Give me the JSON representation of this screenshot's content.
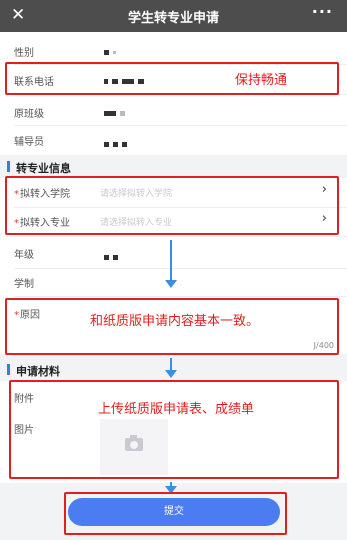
{
  "header": {
    "close_icon": "close-icon",
    "title": "学生转专业申请",
    "more": "···"
  },
  "basic_info": {
    "gender_label": "性别",
    "phone_label": "联系电话",
    "original_class_label": "原班级",
    "counselor_label": "辅导员"
  },
  "transfer_section": {
    "title": "转专业信息",
    "college_label": "拟转入学院",
    "college_placeholder": "请选择拟转入学院",
    "major_label": "拟转入专业",
    "major_placeholder": "请选择拟转入专业",
    "grade_label": "年级",
    "duration_label": "学制",
    "reason_label": "原因",
    "reason_counter": "J/400"
  },
  "materials_section": {
    "title": "申请材料",
    "attachment_label": "附件",
    "image_label": "图片"
  },
  "submit_label": "提交",
  "annotations": {
    "phone_note": "保持畅通",
    "reason_note": "和纸质版申请内容基本一致。",
    "materials_note": "上传纸质版申请表、成绩单"
  },
  "colors": {
    "header_bg": "#4d4d4d",
    "accent": "#4c7cf2",
    "annotation_red": "#e02020",
    "arrow_blue": "#3a8ee6"
  }
}
